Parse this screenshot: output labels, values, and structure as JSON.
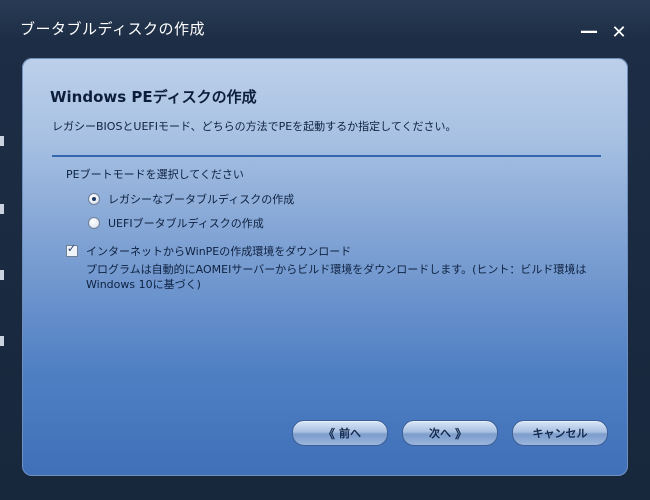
{
  "window": {
    "title": "ブータブルディスクの作成",
    "minimize_glyph": "—",
    "close_glyph": "✕"
  },
  "panel": {
    "heading": "Windows PEディスクの作成",
    "subtext": "レガシーBIOSとUEFIモード、どちらの方法でPEを起動するか指定してください。"
  },
  "boot_mode": {
    "label": "PEブートモードを選択してください",
    "options": [
      {
        "label": "レガシーなブータブルディスクの作成",
        "selected": true
      },
      {
        "label": "UEFIブータブルディスクの作成",
        "selected": false
      }
    ]
  },
  "download": {
    "label": "インターネットからWinPEの作成環境をダウンロード",
    "checked": true,
    "description": "プログラムは自動的にAOMEIサーバーからビルド環境をダウンロードします。(ヒント：ビルド環境はWindows 10に基づく)"
  },
  "buttons": {
    "back": "前へ",
    "next": "次へ",
    "cancel": "キャンセル",
    "back_chevron": "《",
    "next_chevron": "》"
  },
  "colors": {
    "panel_top": "#bcd0ea",
    "panel_bottom": "#3f70b8",
    "divider": "#3567b0",
    "frame": "#1c2d45"
  }
}
